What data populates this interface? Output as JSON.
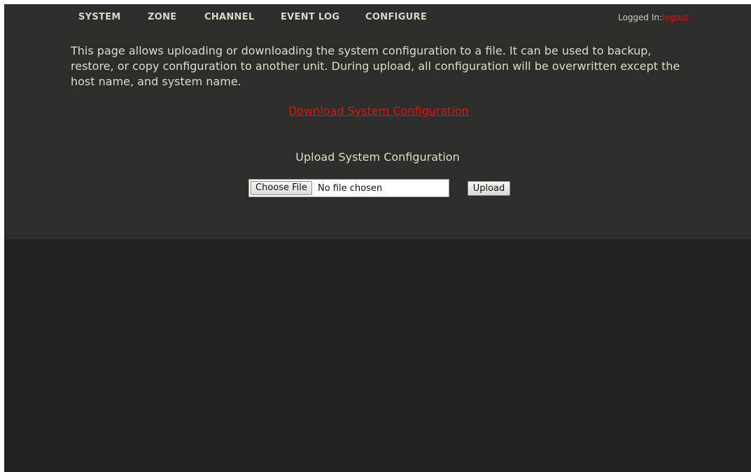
{
  "nav": {
    "items": [
      {
        "label": "SYSTEM"
      },
      {
        "label": "ZONE"
      },
      {
        "label": "CHANNEL"
      },
      {
        "label": "EVENT LOG"
      },
      {
        "label": "CONFIGURE"
      }
    ]
  },
  "session": {
    "logged_in_label": "Logged In:",
    "logout_label": "logout"
  },
  "content": {
    "description": "This page allows uploading or downloading the system configuration to a file. It can be used to backup, restore, or copy configuration to another unit. During upload, all configuration will be overwritten except the host name, and system name.",
    "download_link": "Download System Configuration",
    "upload_title": "Upload System Configuration",
    "choose_file_label": "Choose File",
    "file_status": "No file chosen",
    "upload_label": "Upload"
  },
  "colors": {
    "page_background": "#212121",
    "panel_background": "#2d2d29",
    "link_red": "#e2130f",
    "text": "#dcdcd2"
  }
}
